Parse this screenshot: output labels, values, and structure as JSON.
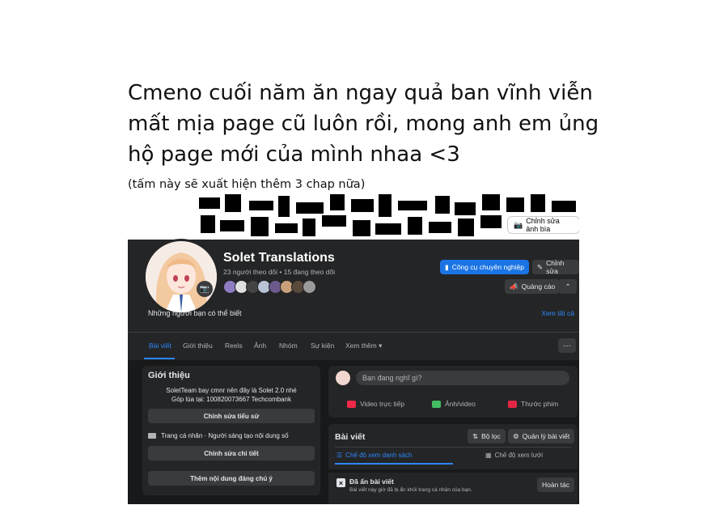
{
  "notice": {
    "line1": "Cmeno cuối năm ăn ngay quả ban vĩnh viễn",
    "line2": "mất mịa page cũ luôn rồi, mong anh em ủng",
    "line3": "hộ page mới của mình nhaa <3",
    "note": "(tấm này sẽ xuất hiện thêm 3 chap nữa)"
  },
  "facebook": {
    "cover_edit_label": "Chỉnh sửa ảnh bìa",
    "page_name": "Solet Translations",
    "followers_text": "23 người theo dõi • 15 đang theo dõi",
    "buttons": {
      "pro_tools": "Công cụ chuyên nghiệp",
      "edit": "Chỉnh sửa",
      "advertise": "Quảng cáo",
      "collapse": "⌃"
    },
    "people_you_may_know": "Những người bạn có thể biết",
    "see_all": "Xem tất cả",
    "tabs": [
      "Bài viết",
      "Giới thiệu",
      "Reels",
      "Ảnh",
      "Nhóm",
      "Sự kiện",
      "Xem thêm ▾"
    ],
    "more_dots": "···",
    "intro": {
      "title": "Giới thiệu",
      "bio_line1": "SoletTeam bay cmnr nên đây là Solet 2.0 nhé",
      "bio_line2": "Góp lúa tại: 100820073667 Techcombank",
      "edit_bio": "Chỉnh sửa tiểu sử",
      "category": "Trang cá nhân · Người sáng tạo nội dung số",
      "edit_details": "Chỉnh sửa chi tiết",
      "add_featured": "Thêm nội dung đáng chú ý"
    },
    "composer": {
      "placeholder": "Bạn đang nghĩ gì?",
      "live_video": "Video trực tiếp",
      "photo_video": "Ảnh/video",
      "reel": "Thước phim"
    },
    "posts": {
      "title": "Bài viết",
      "filter": "Bộ lọc",
      "manage": "Quản lý bài viết",
      "list_view": "Chế độ xem danh sách",
      "grid_view": "Chế độ xem lưới",
      "hidden_title": "Đã ẩn bài viết",
      "hidden_desc": "Bài viết này giờ đã bị ẩn khỏi trang cá nhân của bạn.",
      "undo": "Hoàn tác"
    },
    "colors": {
      "accent": "#2d88ff",
      "button_blue": "#1b74e4",
      "surface": "#242526",
      "background": "#18191a"
    }
  }
}
